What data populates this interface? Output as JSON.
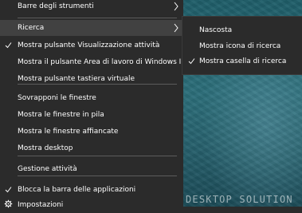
{
  "menu": {
    "items": [
      {
        "label": "Barre degli strumenti",
        "has_submenu": true
      },
      {
        "label": "Ricerca",
        "has_submenu": true
      },
      {
        "label": "Mostra pulsante Visualizzazione attività",
        "checked": true
      },
      {
        "label": "Mostra il pulsante Area di lavoro di Windows Ink"
      },
      {
        "label": "Mostra pulsante tastiera virtuale"
      },
      {
        "label": "Sovrapponi le finestre"
      },
      {
        "label": "Mostra le finestre in pila"
      },
      {
        "label": "Mostra le finestre affiancate"
      },
      {
        "label": "Mostra desktop"
      },
      {
        "label": "Gestione attività"
      },
      {
        "label": "Blocca la barra delle applicazioni",
        "checked": true
      },
      {
        "label": "Impostazioni",
        "icon": "gear-icon"
      }
    ]
  },
  "submenu": {
    "items": [
      {
        "label": "Nascosta"
      },
      {
        "label": "Mostra icona di ricerca"
      },
      {
        "label": "Mostra casella di ricerca",
        "checked": true
      }
    ]
  },
  "desktop": {
    "watermark": "DESKTOP SOLUTION"
  },
  "colors": {
    "menu_bg": "#2b2b2b",
    "hover": "#414141",
    "separator": "#5c5c5c",
    "text": "#ffffff"
  }
}
